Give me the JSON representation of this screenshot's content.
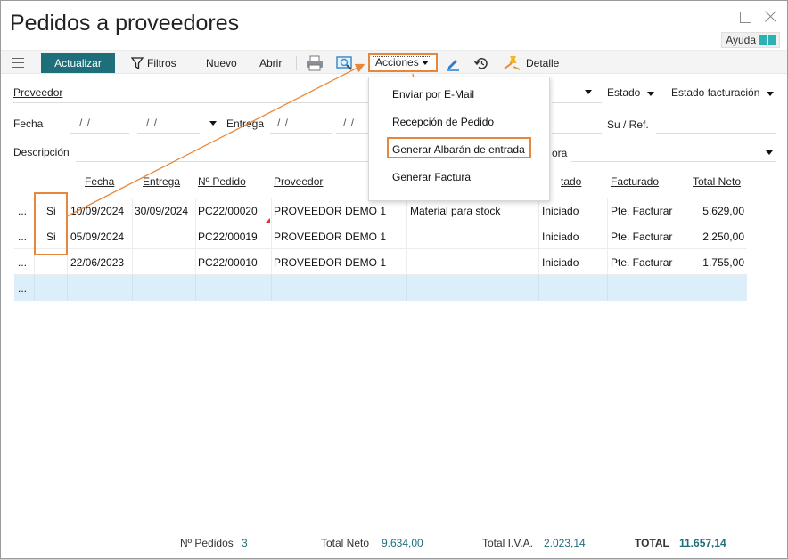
{
  "window": {
    "title": "Pedidos a proveedores",
    "help_label": "Ayuda"
  },
  "toolbar": {
    "update": "Actualizar",
    "filters": "Filtros",
    "new": "Nuevo",
    "open": "Abrir",
    "actions": "Acciones",
    "detail": "Detalle"
  },
  "filters": {
    "supplier": "Proveedor",
    "status": "Estado",
    "billing_status": "Estado facturación",
    "date": "Fecha",
    "date_from": "/ /",
    "date_to": "/ /",
    "delivery": "Entrega",
    "delivery_from": "/ /",
    "delivery_to": "/ /",
    "your_ref": "Su / Ref.",
    "description": "Descripción",
    "truncated_label": "ora"
  },
  "menu": {
    "items": [
      "Enviar por E-Mail",
      "Recepción de Pedido",
      "Generar Albarán de entrada",
      "Generar Factura"
    ]
  },
  "table": {
    "headers": [
      "Fecha",
      "Entrega",
      "Nº Pedido",
      "Proveedor",
      "tado",
      "Facturado",
      "Total Neto"
    ],
    "rows": [
      {
        "dots": "...",
        "flag": "Si",
        "date": "10/09/2024",
        "delivery": "30/09/2024",
        "order": "PC22/00020",
        "supplier": "PROVEEDOR DEMO 1",
        "desc": "Material para stock",
        "status": "Iniciado",
        "billed": "Pte. Facturar",
        "net": "5.629,00"
      },
      {
        "dots": "...",
        "flag": "Si",
        "date": "05/09/2024",
        "delivery": "",
        "order": "PC22/00019",
        "supplier": "PROVEEDOR DEMO 1",
        "desc": "",
        "status": "Iniciado",
        "billed": "Pte. Facturar",
        "net": "2.250,00"
      },
      {
        "dots": "...",
        "flag": "",
        "date": "22/06/2023",
        "delivery": "",
        "order": "PC22/00010",
        "supplier": "PROVEEDOR DEMO 1",
        "desc": "",
        "status": "Iniciado",
        "billed": "Pte. Facturar",
        "net": "1.755,00"
      }
    ],
    "new_row_dots": "..."
  },
  "footer": {
    "orders_label": "Nº Pedidos",
    "orders_value": "3",
    "net_label": "Total Neto",
    "net_value": "9.634,00",
    "vat_label": "Total I.V.A.",
    "vat_value": "2.023,14",
    "total_label": "TOTAL",
    "total_value": "11.657,14"
  },
  "colors": {
    "accent": "#1e6f7a",
    "highlight": "#e8873a",
    "selected_row": "#dceefa"
  }
}
